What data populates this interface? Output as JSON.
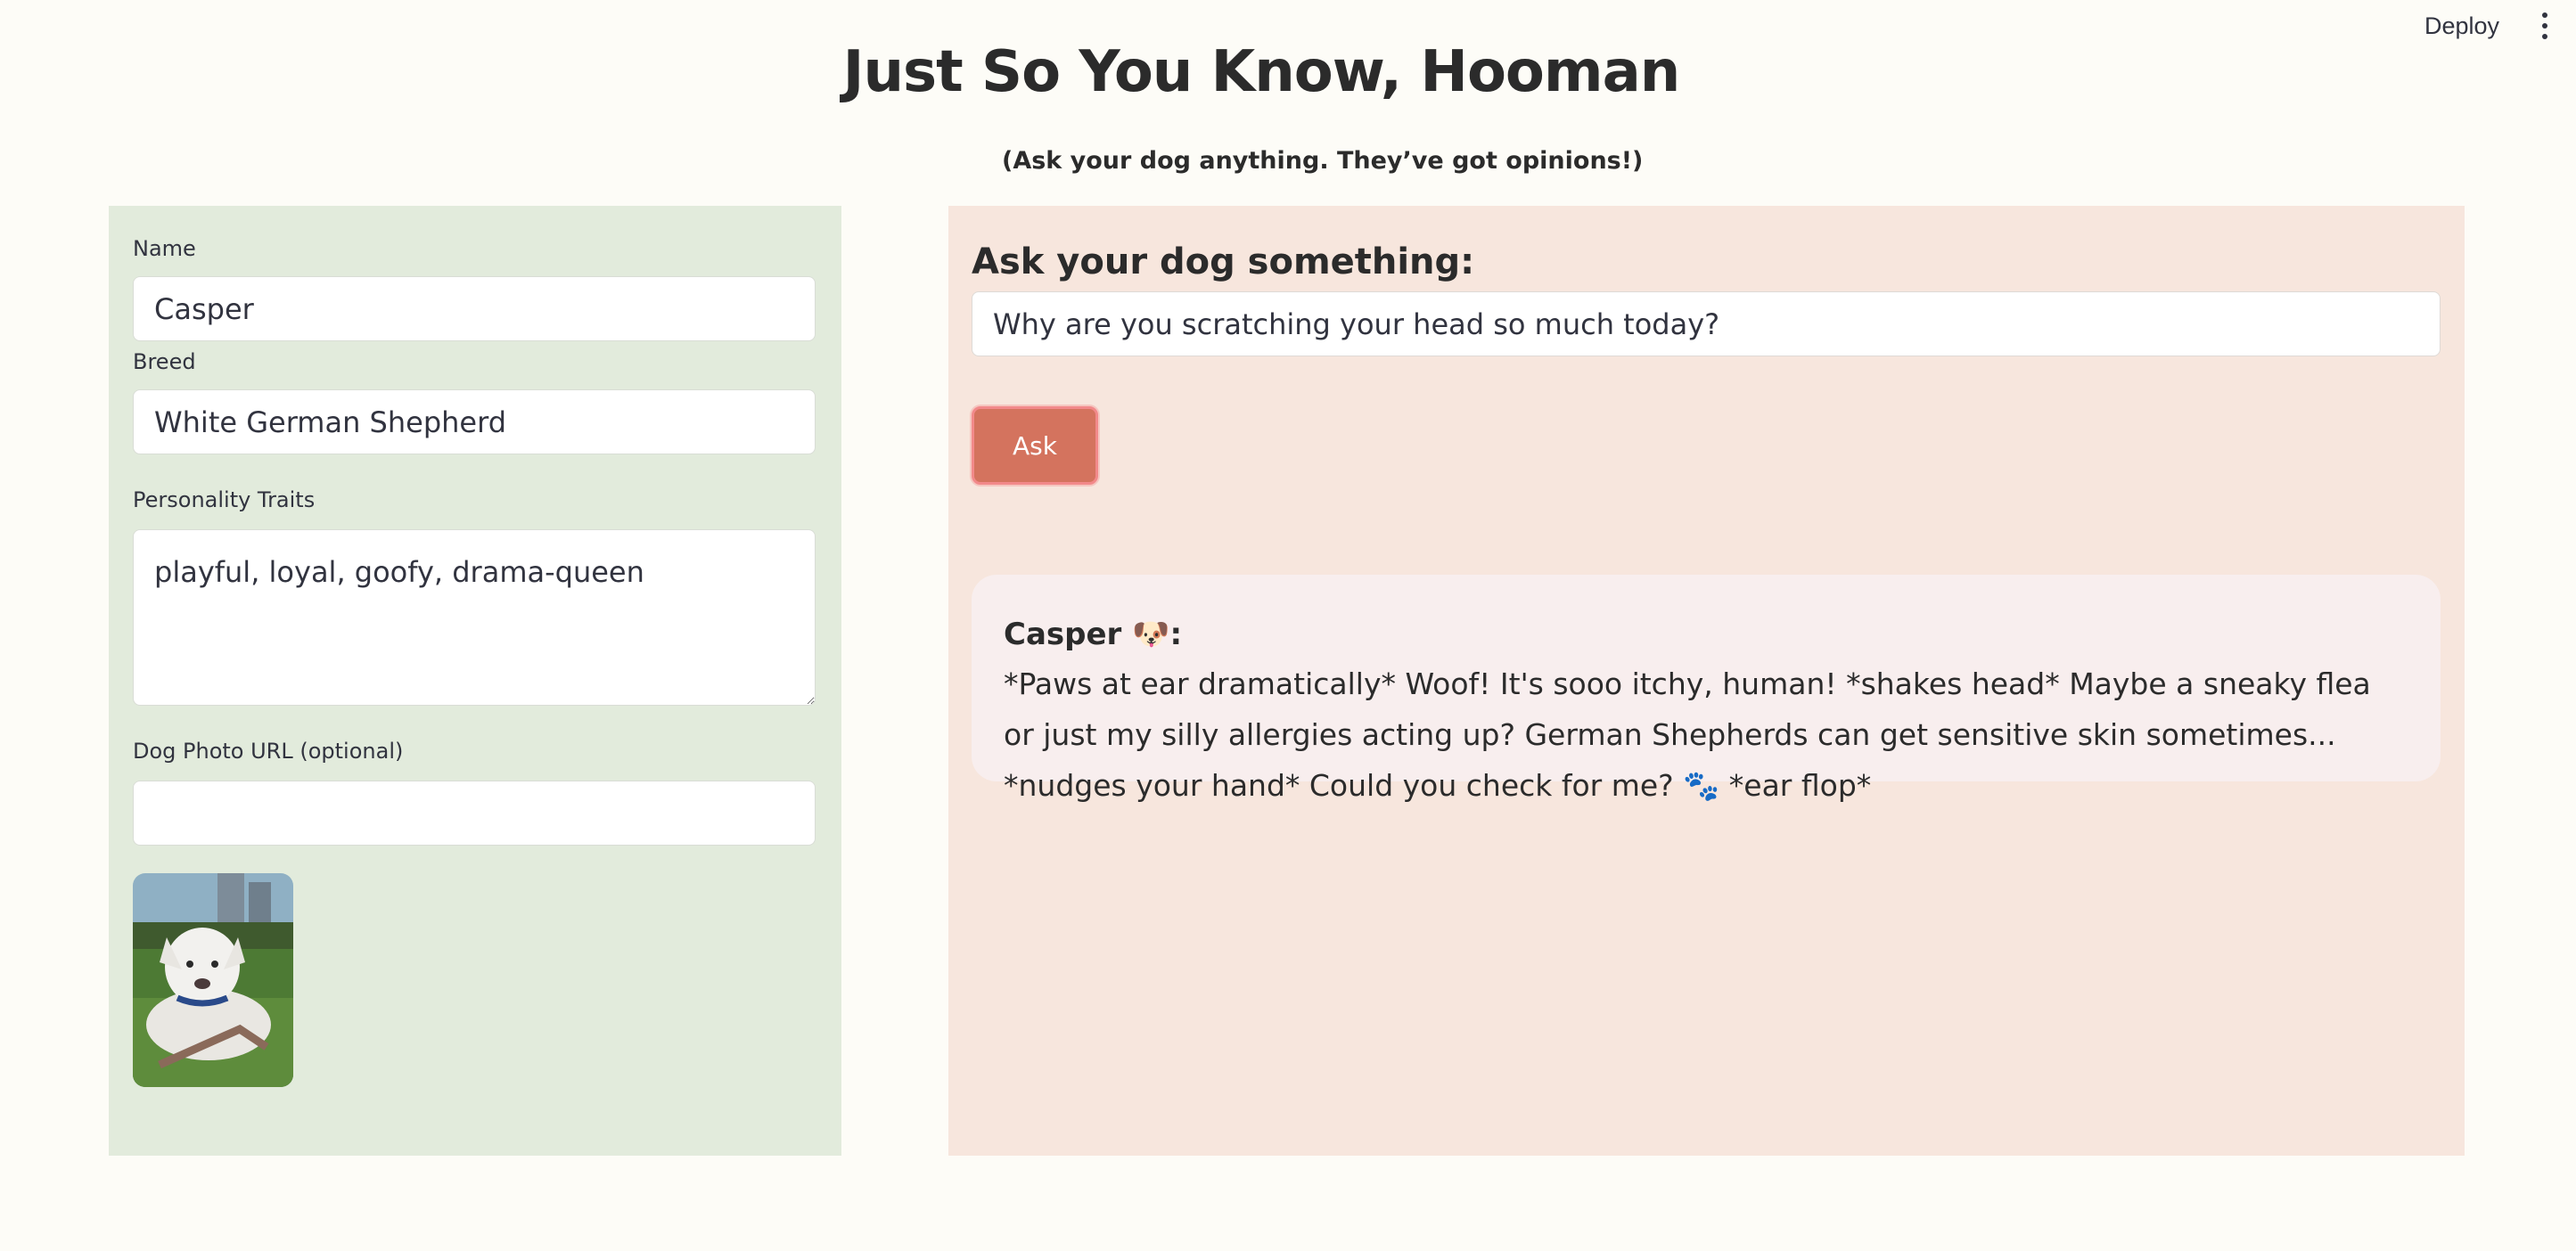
{
  "header": {
    "deploy_label": "Deploy",
    "menu_icon": "kebab-menu-icon"
  },
  "page": {
    "title": "Just So You Know, Hooman",
    "subtitle": "(Ask your dog anything. They’ve got opinions!)"
  },
  "profile": {
    "name_label": "Name",
    "name_value": "Casper",
    "breed_label": "Breed",
    "breed_value": "White German Shepherd",
    "traits_label": "Personality Traits",
    "traits_value": "playful, loyal, goofy, drama-queen",
    "photo_url_label": "Dog Photo URL (optional)",
    "photo_url_value": ""
  },
  "chat": {
    "heading": "Ask your dog something:",
    "question_value": "Why are you scratching your head so much today?",
    "ask_label": "Ask",
    "answer_name": "Casper 🐶:",
    "answer_text": "*Paws at ear dramatically* Woof! It's sooo itchy, human! *shakes head* Maybe a sneaky flea or just my silly allergies acting up? German Shepherds can get sensitive skin sometimes... *nudges your hand* Could you check for me? 🐾 *ear flop*"
  },
  "colors": {
    "background": "#fdfcf7",
    "left_panel": "#e2ebdc",
    "right_panel": "#f7e6dd",
    "button": "#d4735e",
    "button_border": "#f2898a",
    "answer_card": "#f8eeee"
  }
}
